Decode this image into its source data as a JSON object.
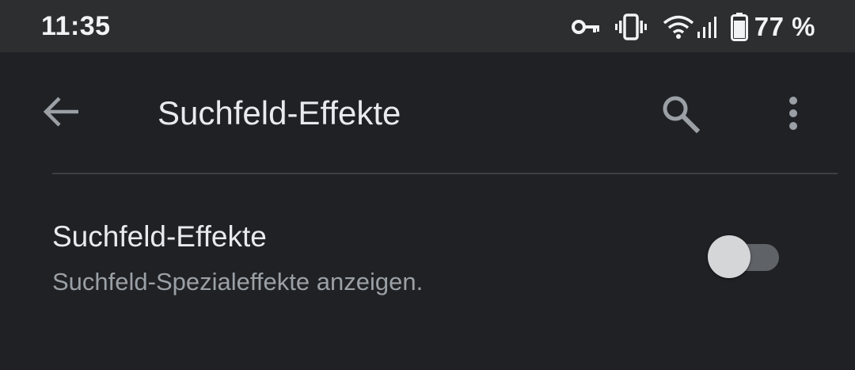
{
  "status_bar": {
    "time": "11:35",
    "icons": [
      "vpn-key-icon",
      "vibrate-icon",
      "wifi-icon",
      "cell-signal-icon",
      "battery-icon"
    ],
    "battery_text": "77 %"
  },
  "app_bar": {
    "back_icon": "arrow-back-icon",
    "title": "Suchfeld-Effekte",
    "search_icon": "search-icon",
    "more_icon": "more-vert-icon"
  },
  "setting": {
    "title": "Suchfeld-Effekte",
    "summary": "Suchfeld-Spezialeffekte anzeigen.",
    "enabled": false
  },
  "colors": {
    "background": "#202124",
    "status_bar": "#2d2e30",
    "primary_text": "#e8eaed",
    "secondary_text": "#9aa0a6",
    "icon": "#9aa0a6",
    "divider": "#3c4043",
    "toggle_track": "#5f6368",
    "toggle_thumb": "#d5d6d7"
  }
}
